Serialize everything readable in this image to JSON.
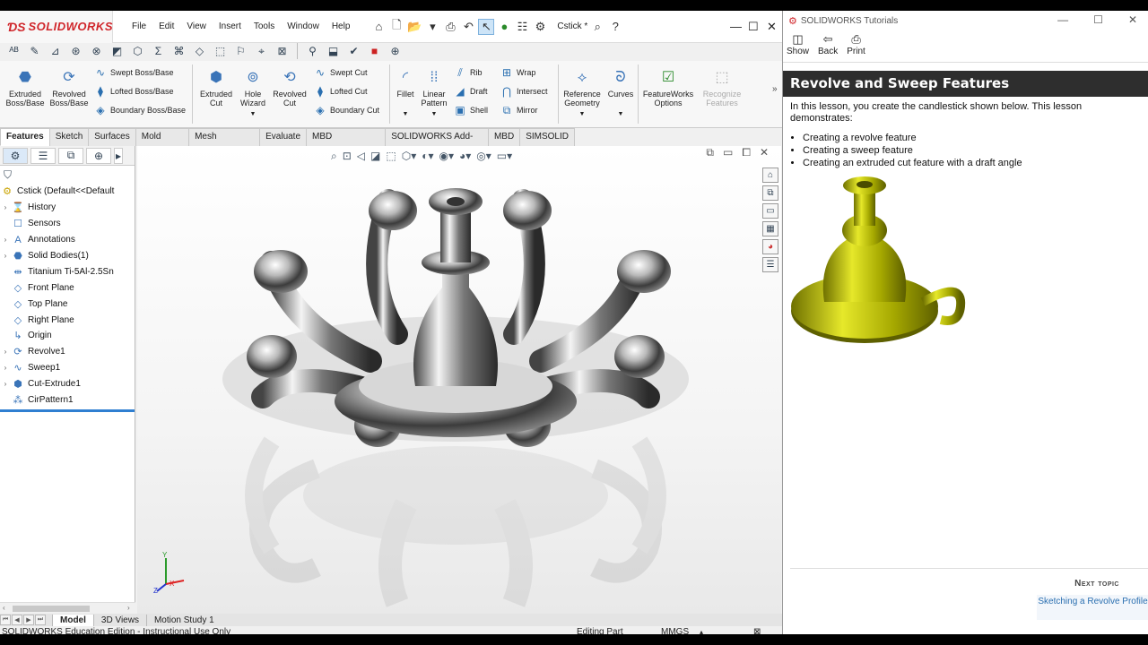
{
  "solidworks": {
    "app_name": "SOLIDWORKS",
    "menu": [
      "File",
      "Edit",
      "View",
      "Insert",
      "Tools",
      "Window",
      "Help"
    ],
    "document_name": "Cstick *",
    "command_manager": {
      "features": {
        "extruded_boss": "Extruded Boss/Base",
        "revolved_boss": "Revolved Boss/Base",
        "swept_boss": "Swept Boss/Base",
        "lofted_boss": "Lofted Boss/Base",
        "boundary_boss": "Boundary Boss/Base",
        "extruded_cut": "Extruded Cut",
        "hole_wizard": "Hole Wizard",
        "revolved_cut": "Revolved Cut",
        "swept_cut": "Swept Cut",
        "lofted_cut": "Lofted Cut",
        "boundary_cut": "Boundary Cut",
        "fillet": "Fillet",
        "linear_pattern": "Linear Pattern",
        "rib": "Rib",
        "draft": "Draft",
        "shell": "Shell",
        "wrap": "Wrap",
        "intersect": "Intersect",
        "mirror": "Mirror",
        "reference_geometry": "Reference Geometry",
        "curves": "Curves",
        "featureworks_options": "FeatureWorks Options",
        "recognize_features": "Recognize Features"
      }
    },
    "tabs": [
      "Features",
      "Sketch",
      "Surfaces",
      "Mold Tools",
      "Mesh Modeling",
      "Evaluate",
      "MBD Dimensions",
      "SOLIDWORKS Add-Ins",
      "MBD",
      "SIMSOLID"
    ],
    "active_tab": "Features",
    "tree": {
      "root": "Cstick  (Default<<Default",
      "nodes": [
        {
          "label": "History",
          "expand": true
        },
        {
          "label": "Sensors",
          "expand": false
        },
        {
          "label": "Annotations",
          "expand": true
        },
        {
          "label": "Solid Bodies(1)",
          "expand": true
        },
        {
          "label": "Titanium Ti-5Al-2.5Sn",
          "expand": false
        },
        {
          "label": "Front Plane",
          "expand": false
        },
        {
          "label": "Top Plane",
          "expand": false
        },
        {
          "label": "Right Plane",
          "expand": false
        },
        {
          "label": "Origin",
          "expand": false
        },
        {
          "label": "Revolve1",
          "expand": true
        },
        {
          "label": "Sweep1",
          "expand": true
        },
        {
          "label": "Cut-Extrude1",
          "expand": true
        },
        {
          "label": "CirPattern1",
          "expand": false
        }
      ]
    },
    "bottom_tabs": [
      "Model",
      "3D Views",
      "Motion Study 1"
    ],
    "active_bottom_tab": "Model",
    "status": {
      "left": "SOLIDWORKS Education Edition - Instructional Use Only",
      "mode": "Editing Part",
      "units": "MMGS",
      "units_arrow": "▴"
    },
    "axes": {
      "x": "X",
      "y": "Y",
      "z": "Z"
    },
    "colors": {
      "brand_red": "#d0262b",
      "model_metal": "#9a9a9a",
      "tutorial_gold": "#b5b800"
    }
  },
  "tutorial": {
    "window_title": "SOLIDWORKS Tutorials",
    "toolbar": [
      "Show",
      "Back",
      "Print"
    ],
    "heading": "Revolve and Sweep Features",
    "intro": "In this lesson, you create the candlestick shown below. This lesson demonstrates:",
    "bullets": [
      "Creating a revolve feature",
      "Creating a sweep feature",
      "Creating an extruded cut feature with a draft angle"
    ],
    "next_topic_label": "Next topic",
    "next_topic_link": "Sketching a Revolve Profile"
  }
}
